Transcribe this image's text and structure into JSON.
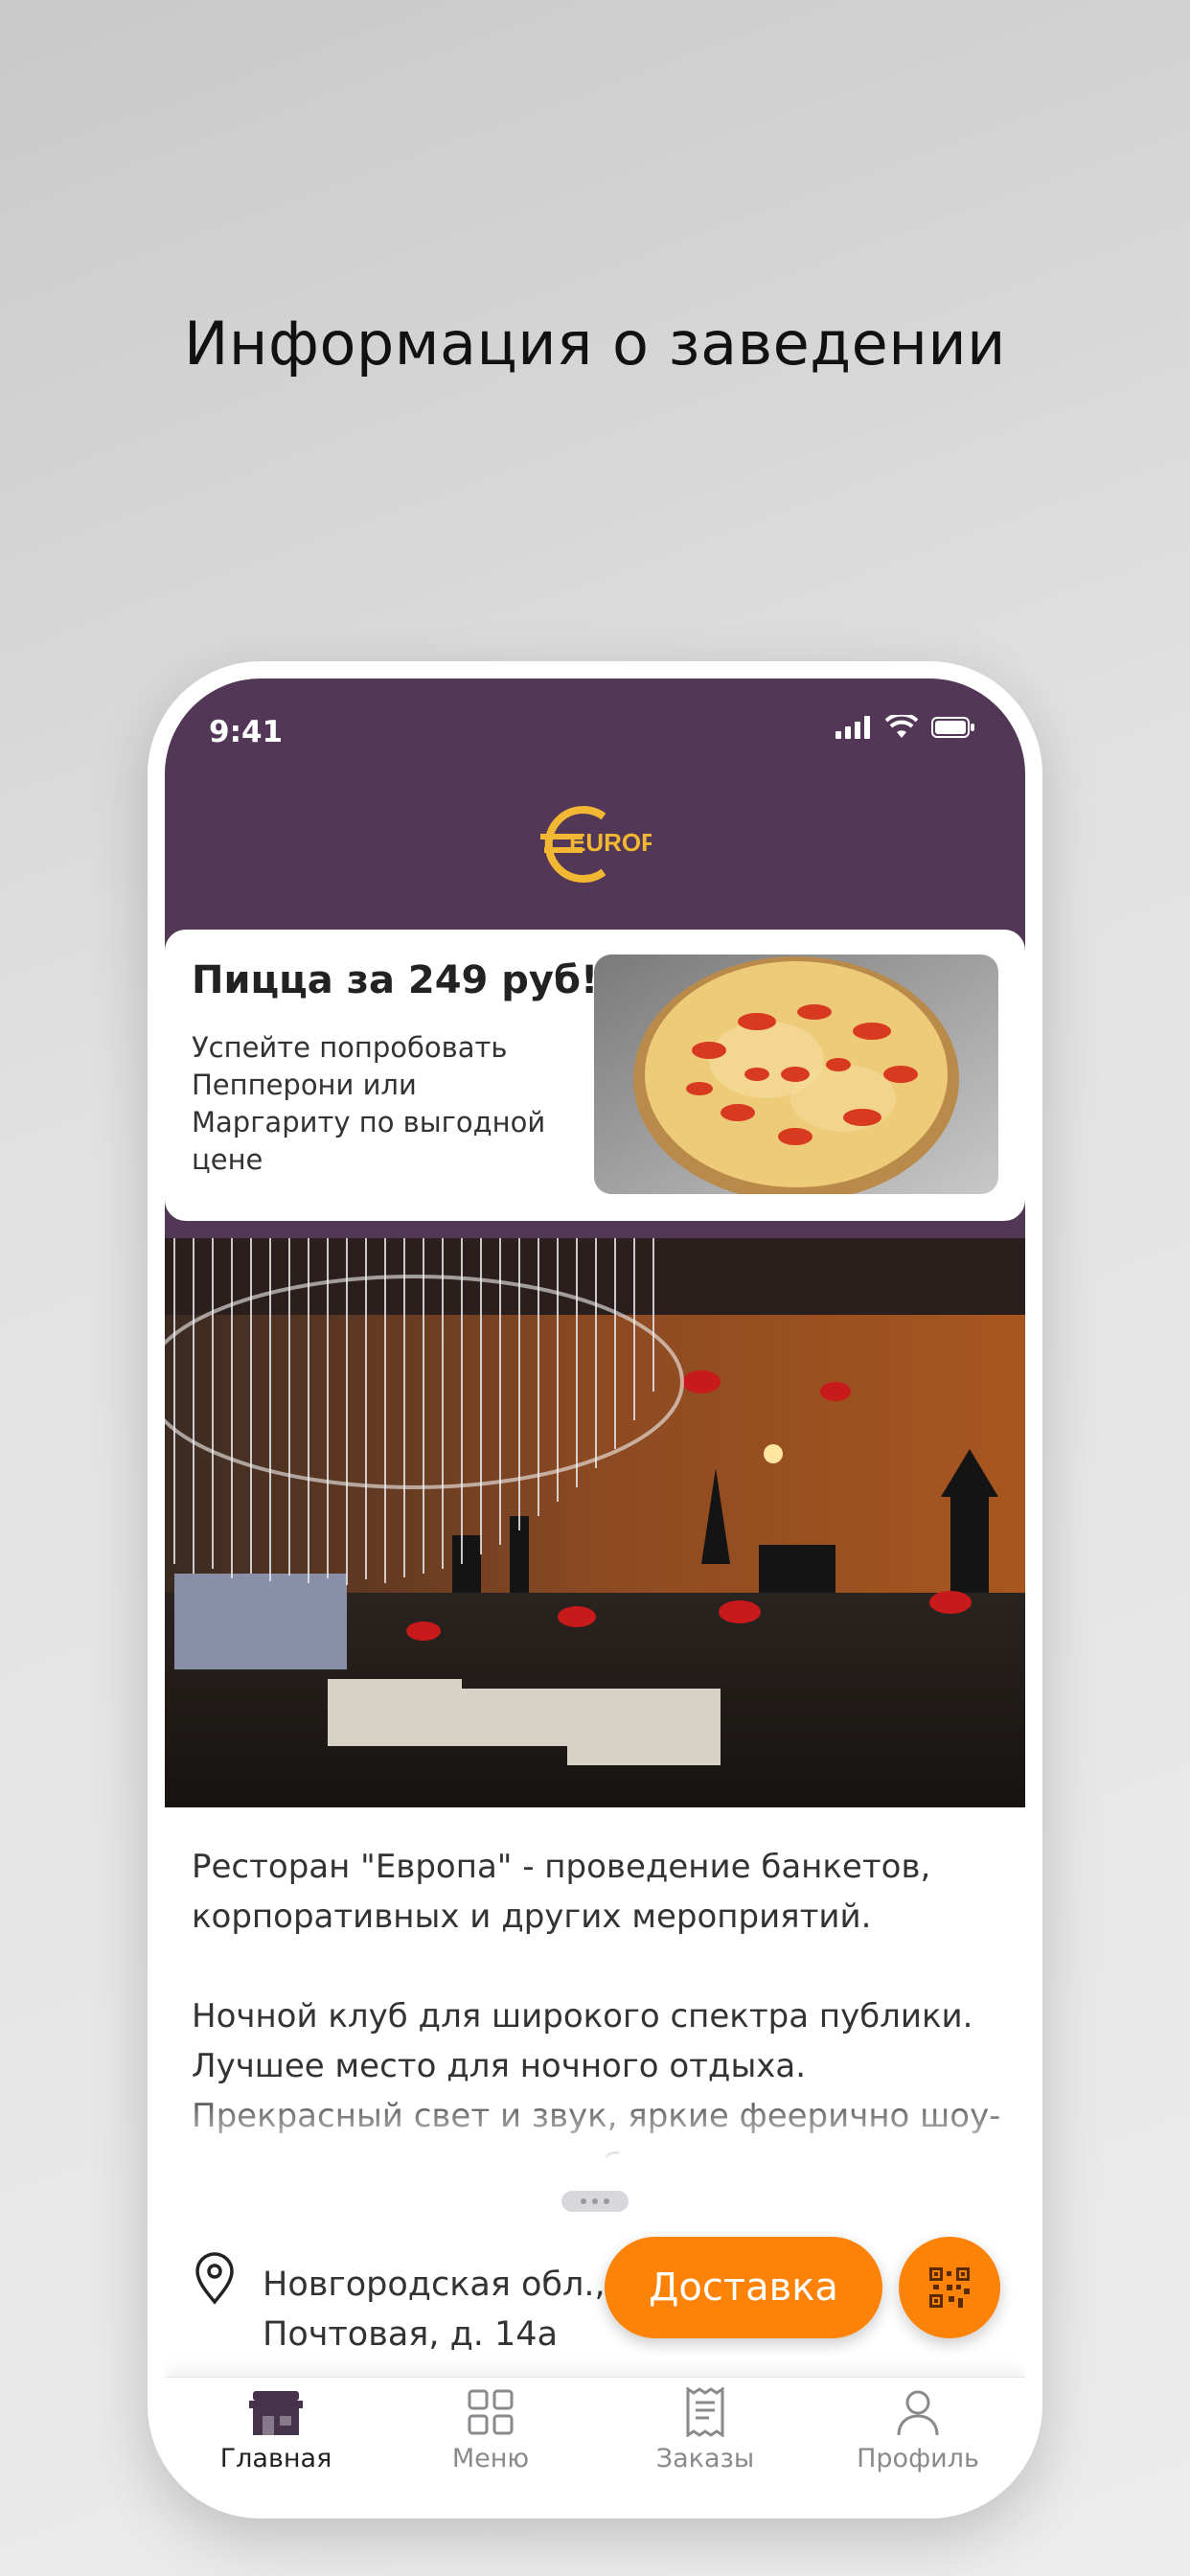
{
  "headline": "Информация о заведении",
  "status_bar": {
    "time": "9:41"
  },
  "logo": {
    "text": "EUROPA"
  },
  "promo": {
    "title": "Пицца за 249 руб!",
    "text": "Успейте попробовать Пепперони или Маргариту по выгодной цене"
  },
  "description": "Ресторан \"Европа\" - проведение банкетов, корпоративных и других мероприятий.\n\nНочной клуб для широкого спектра публики. Лучшее место для ночного отдыха. Прекрасный свет и звук, яркие феерично шоу-программы и море незабываемых",
  "address": "Новгородская обл., г.\nПочтовая, д. 14а",
  "buttons": {
    "delivery": "Доставка"
  },
  "tabbar": {
    "items": [
      {
        "label": "Главная",
        "icon": "home-icon",
        "active": true
      },
      {
        "label": "Меню",
        "icon": "grid-icon",
        "active": false
      },
      {
        "label": "Заказы",
        "icon": "receipt-icon",
        "active": false
      },
      {
        "label": "Профиль",
        "icon": "profile-icon",
        "active": false
      }
    ]
  },
  "colors": {
    "header": "#523756",
    "accent": "#fd8208",
    "logo": "#f2b733"
  }
}
